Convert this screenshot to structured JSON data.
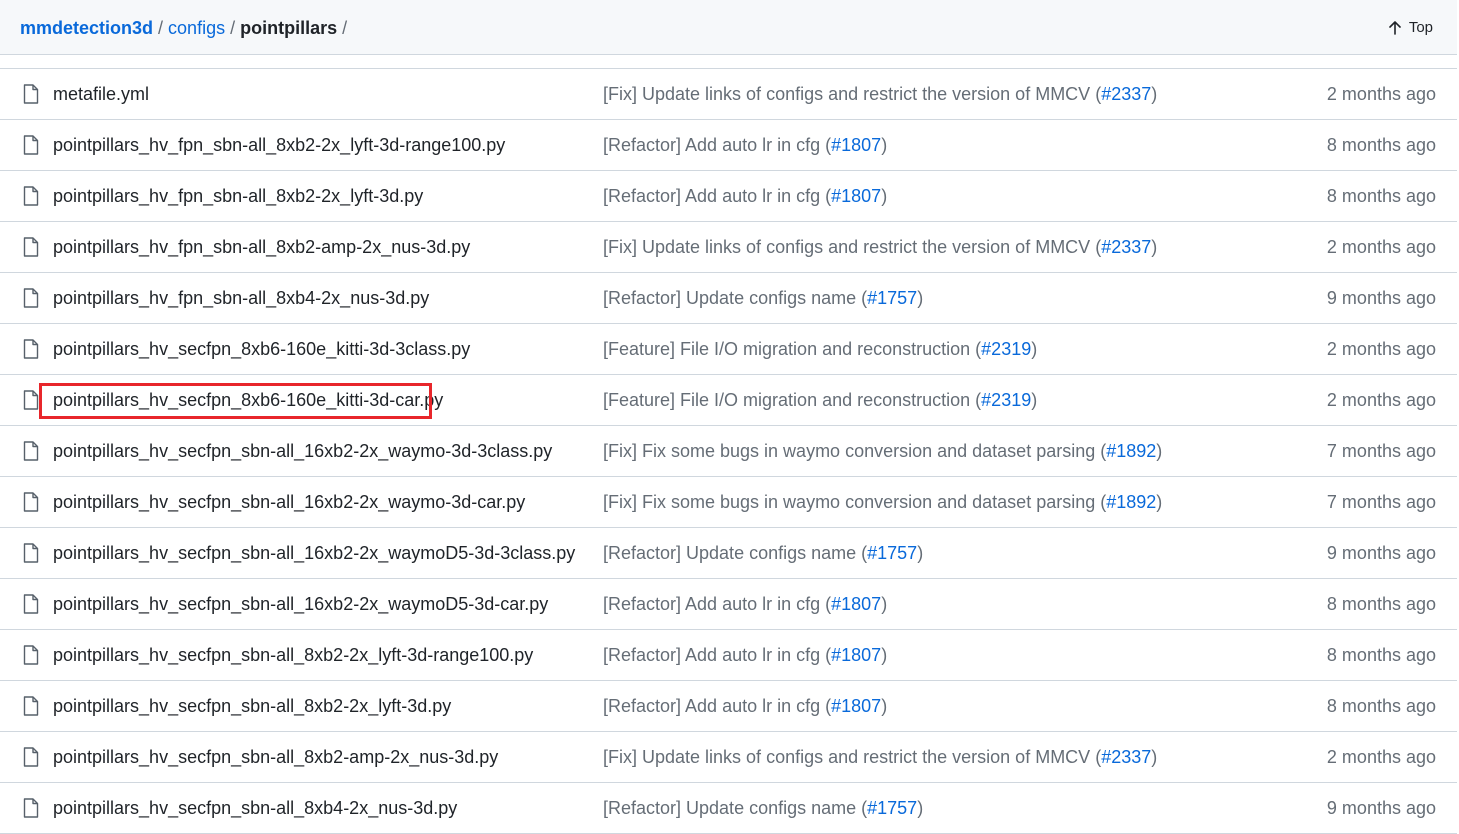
{
  "breadcrumb": {
    "repo": "mmdetection3d",
    "sep": "/",
    "configs": "configs",
    "current": "pointpillars",
    "trailing": "/"
  },
  "top_button": {
    "label": "Top",
    "icon": "arrow-up-icon"
  },
  "highlight_color": "#e8262b",
  "files": [
    {
      "name": "metafile.yml",
      "msg_prefix": "[Fix] Update links of configs and restrict the version of MMCV (",
      "pr": "#2337",
      "msg_suffix": ")",
      "age": "2 months ago"
    },
    {
      "name": "pointpillars_hv_fpn_sbn-all_8xb2-2x_lyft-3d-range100.py",
      "msg_prefix": "[Refactor] Add auto lr in cfg (",
      "pr": "#1807",
      "msg_suffix": ")",
      "age": "8 months ago"
    },
    {
      "name": "pointpillars_hv_fpn_sbn-all_8xb2-2x_lyft-3d.py",
      "msg_prefix": "[Refactor] Add auto lr in cfg (",
      "pr": "#1807",
      "msg_suffix": ")",
      "age": "8 months ago"
    },
    {
      "name": "pointpillars_hv_fpn_sbn-all_8xb2-amp-2x_nus-3d.py",
      "msg_prefix": "[Fix] Update links of configs and restrict the version of MMCV (",
      "pr": "#2337",
      "msg_suffix": ")",
      "age": "2 months ago"
    },
    {
      "name": "pointpillars_hv_fpn_sbn-all_8xb4-2x_nus-3d.py",
      "msg_prefix": "[Refactor] Update configs name (",
      "pr": "#1757",
      "msg_suffix": ")",
      "age": "9 months ago"
    },
    {
      "name": "pointpillars_hv_secfpn_8xb6-160e_kitti-3d-3class.py",
      "msg_prefix": "[Feature] File I/O migration and reconstruction (",
      "pr": "#2319",
      "msg_suffix": ")",
      "age": "2 months ago"
    },
    {
      "name": "pointpillars_hv_secfpn_8xb6-160e_kitti-3d-car.py",
      "msg_prefix": "[Feature] File I/O migration and reconstruction (",
      "pr": "#2319",
      "msg_suffix": ")",
      "age": "2 months ago",
      "highlighted": true
    },
    {
      "name": "pointpillars_hv_secfpn_sbn-all_16xb2-2x_waymo-3d-3class.py",
      "msg_prefix": "[Fix] Fix some bugs in waymo conversion and dataset parsing (",
      "pr": "#1892",
      "msg_suffix": ")",
      "age": "7 months ago"
    },
    {
      "name": "pointpillars_hv_secfpn_sbn-all_16xb2-2x_waymo-3d-car.py",
      "msg_prefix": "[Fix] Fix some bugs in waymo conversion and dataset parsing (",
      "pr": "#1892",
      "msg_suffix": ")",
      "age": "7 months ago"
    },
    {
      "name": "pointpillars_hv_secfpn_sbn-all_16xb2-2x_waymoD5-3d-3class.py",
      "msg_prefix": "[Refactor] Update configs name (",
      "pr": "#1757",
      "msg_suffix": ")",
      "age": "9 months ago"
    },
    {
      "name": "pointpillars_hv_secfpn_sbn-all_16xb2-2x_waymoD5-3d-car.py",
      "msg_prefix": "[Refactor] Add auto lr in cfg (",
      "pr": "#1807",
      "msg_suffix": ")",
      "age": "8 months ago"
    },
    {
      "name": "pointpillars_hv_secfpn_sbn-all_8xb2-2x_lyft-3d-range100.py",
      "msg_prefix": "[Refactor] Add auto lr in cfg (",
      "pr": "#1807",
      "msg_suffix": ")",
      "age": "8 months ago"
    },
    {
      "name": "pointpillars_hv_secfpn_sbn-all_8xb2-2x_lyft-3d.py",
      "msg_prefix": "[Refactor] Add auto lr in cfg (",
      "pr": "#1807",
      "msg_suffix": ")",
      "age": "8 months ago"
    },
    {
      "name": "pointpillars_hv_secfpn_sbn-all_8xb2-amp-2x_nus-3d.py",
      "msg_prefix": "[Fix] Update links of configs and restrict the version of MMCV (",
      "pr": "#2337",
      "msg_suffix": ")",
      "age": "2 months ago"
    },
    {
      "name": "pointpillars_hv_secfpn_sbn-all_8xb4-2x_nus-3d.py",
      "msg_prefix": "[Refactor] Update configs name (",
      "pr": "#1757",
      "msg_suffix": ")",
      "age": "9 months ago"
    }
  ]
}
